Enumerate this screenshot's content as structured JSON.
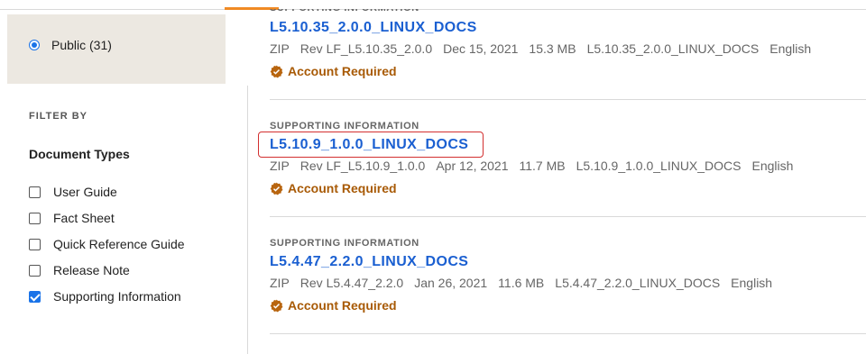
{
  "access": {
    "option_label": "Public (31)"
  },
  "filters": {
    "heading": "FILTER BY",
    "group_title": "Document Types",
    "options": [
      {
        "label": "User Guide",
        "checked": false
      },
      {
        "label": "Fact Sheet",
        "checked": false
      },
      {
        "label": "Quick Reference Guide",
        "checked": false
      },
      {
        "label": "Release Note",
        "checked": false
      },
      {
        "label": "Supporting Information",
        "checked": true
      }
    ]
  },
  "results": [
    {
      "category": "SUPPORTING INFORMATION",
      "title": "L5.10.35_2.0.0_LINUX_DOCS",
      "meta": [
        "ZIP",
        "Rev LF_L5.10.35_2.0.0",
        "Dec 15, 2021",
        "15.3 MB",
        "L5.10.35_2.0.0_LINUX_DOCS",
        "English"
      ],
      "access": "Account Required"
    },
    {
      "category": "SUPPORTING INFORMATION",
      "title": "L5.10.9_1.0.0_LINUX_DOCS",
      "meta": [
        "ZIP",
        "Rev LF_L5.10.9_1.0.0",
        "Apr 12, 2021",
        "11.7 MB",
        "L5.10.9_1.0.0_LINUX_DOCS",
        "English"
      ],
      "access": "Account Required"
    },
    {
      "category": "SUPPORTING INFORMATION",
      "title": "L5.4.47_2.2.0_LINUX_DOCS",
      "meta": [
        "ZIP",
        "Rev L5.4.47_2.2.0",
        "Jan 26, 2021",
        "11.6 MB",
        "L5.4.47_2.2.0_LINUX_DOCS",
        "English"
      ],
      "access": "Account Required"
    }
  ],
  "colors": {
    "link": "#1a5fd1",
    "account_required": "#a85a06",
    "accent": "#f08a24",
    "highlight": "#d32f2f"
  }
}
